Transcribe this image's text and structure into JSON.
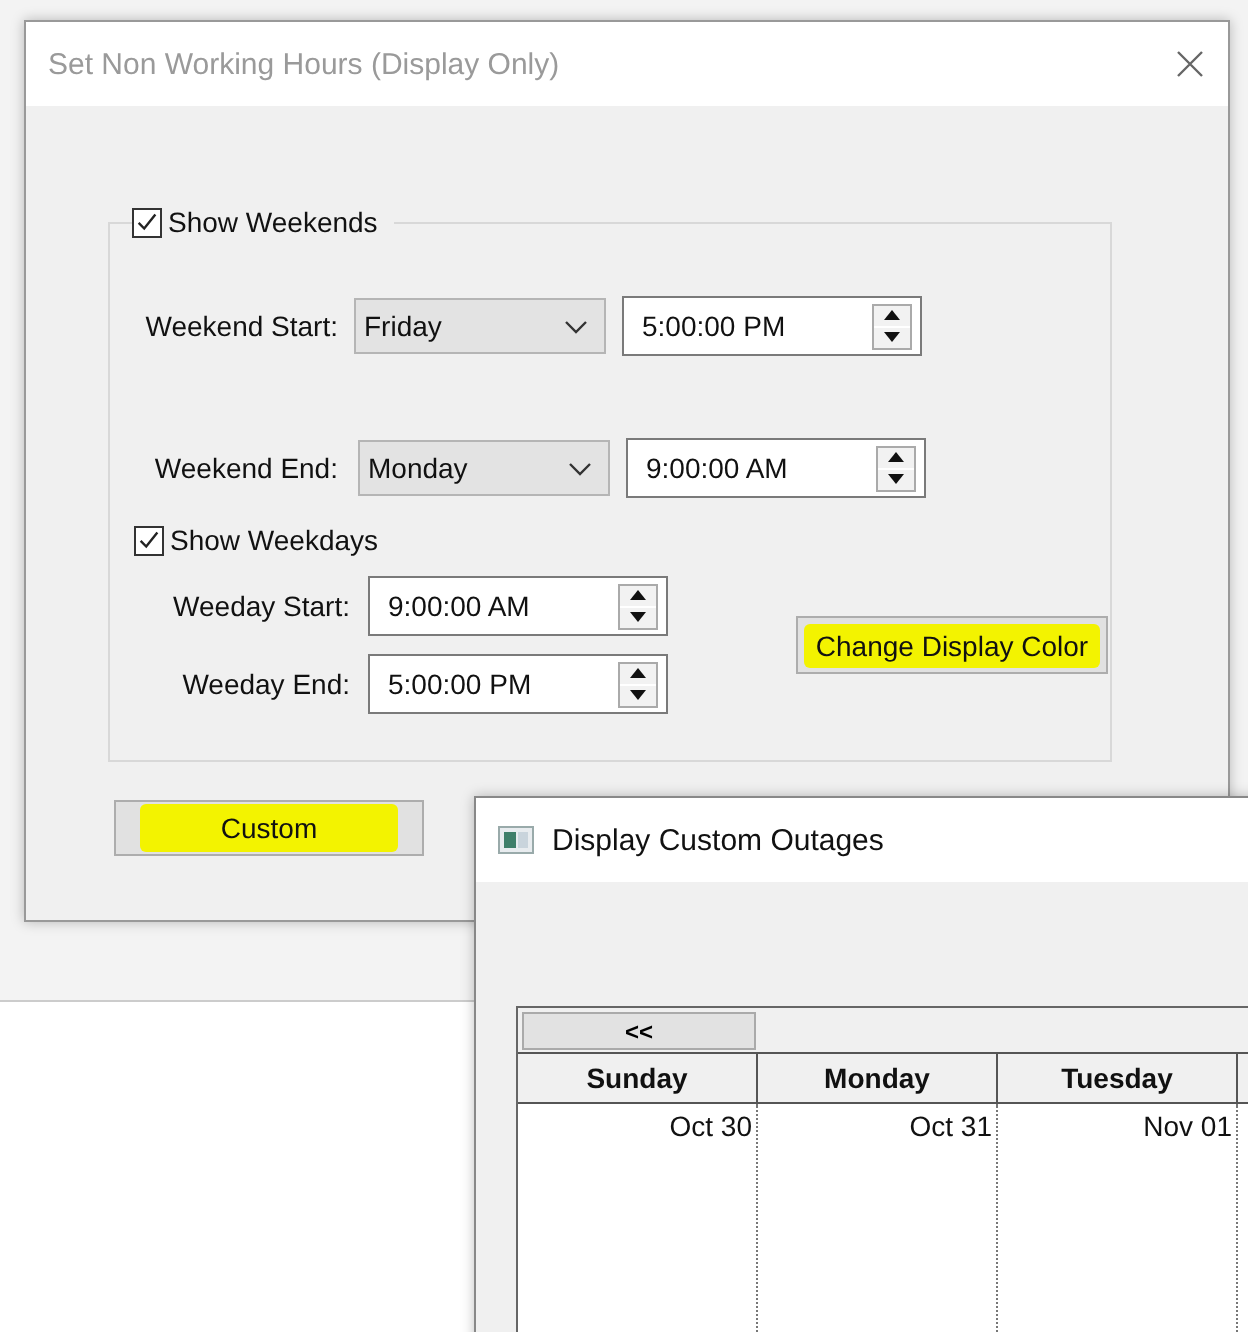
{
  "dialog": {
    "title": "Set Non Working Hours (Display Only)",
    "weekends": {
      "label": "Show Weekends",
      "checked": true,
      "start": {
        "label": "Weekend Start:",
        "day": "Friday",
        "time": "5:00:00 PM"
      },
      "end": {
        "label": "Weekend End:",
        "day": "Monday",
        "time": "9:00:00 AM"
      }
    },
    "weekdays": {
      "label": "Show Weekdays",
      "checked": true,
      "start": {
        "label": "Weeday Start:",
        "time": "9:00:00 AM"
      },
      "end": {
        "label": "Weeday End:",
        "time": "5:00:00 PM"
      }
    },
    "color_button": {
      "label": "Change Display Color",
      "highlighted": true
    },
    "custom_button": {
      "label": "Custom",
      "highlighted": true
    }
  },
  "outages_window": {
    "title": "Display Custom Outages",
    "prev_button": "<<",
    "days": [
      {
        "name": "Sunday",
        "date": "Oct 30"
      },
      {
        "name": "Monday",
        "date": "Oct 31"
      },
      {
        "name": "Tuesday",
        "date": "Nov 01"
      }
    ]
  }
}
